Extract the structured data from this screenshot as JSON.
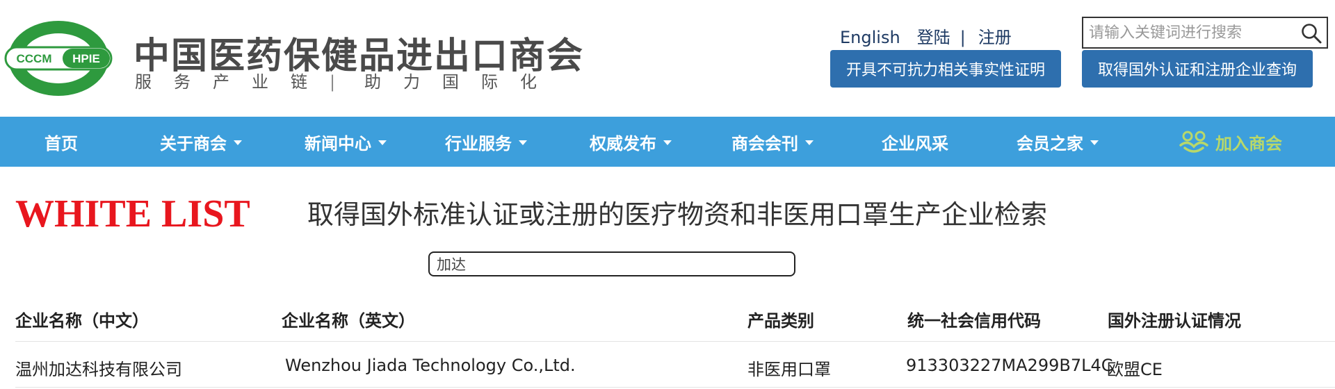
{
  "header": {
    "logo_text_left": "CCCM",
    "logo_text_right": "HPIE",
    "org_name": "中国医药保健品进出口商会",
    "tagline_left": [
      "服",
      "务",
      "产",
      "业",
      "链"
    ],
    "tagline_sep": "|",
    "tagline_right": [
      "助",
      "力",
      "国",
      "际",
      "化"
    ],
    "links": {
      "english": "English",
      "login": "登陆",
      "divider": "|",
      "register": "注册"
    },
    "search": {
      "placeholder": "请输入关键词进行搜索",
      "icon": "search-icon"
    },
    "buttons": {
      "force_majeure": "开具不可抗力相关事实性证明",
      "cert_query": "取得国外认证和注册企业查询"
    }
  },
  "nav": {
    "items": [
      {
        "label": "首页",
        "dropdown": false
      },
      {
        "label": "关于商会",
        "dropdown": true
      },
      {
        "label": "新闻中心",
        "dropdown": true
      },
      {
        "label": "行业服务",
        "dropdown": true
      },
      {
        "label": "权威发布",
        "dropdown": true
      },
      {
        "label": "商会会刊",
        "dropdown": true
      },
      {
        "label": "企业风采",
        "dropdown": false
      },
      {
        "label": "会员之家",
        "dropdown": true
      }
    ],
    "join_label": "加入商会",
    "join_icon": "people-icon"
  },
  "content": {
    "whitelist_logo": "WHITE LIST",
    "title": "取得国外标准认证或注册的医疗物资和非医用口罩生产企业检索",
    "filter_value": "加达"
  },
  "table": {
    "headers": [
      "企业名称（中文）",
      "企业名称（英文）",
      "产品类别",
      "统一社会信用代码",
      "国外注册认证情况"
    ],
    "rows": [
      [
        "温州加达科技有限公司",
        "Wenzhou Jiada Technology Co.,Ltd.",
        "非医用口罩",
        "913303227MA299B7L4C",
        "欧盟CE"
      ]
    ]
  },
  "colors": {
    "brand_green": "#2e9a3e",
    "nav_blue": "#3d9fdc",
    "button_blue": "#2e6fae",
    "whitelist_red": "#e8161e",
    "join_green": "#b8d86a"
  }
}
